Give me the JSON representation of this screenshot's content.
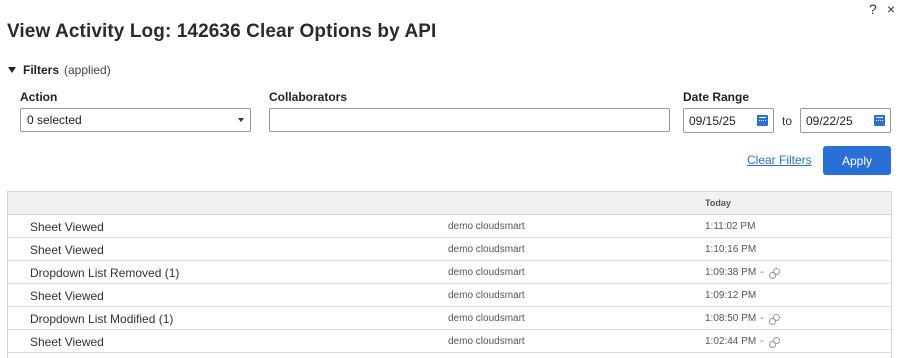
{
  "header": {
    "title": "View Activity Log: 142636 Clear Options by API",
    "help_icon": "?",
    "close_icon": "×"
  },
  "filters": {
    "label": "Filters",
    "status": "(applied)",
    "action_label": "Action",
    "action_value": "0 selected",
    "collaborators_label": "Collaborators",
    "collaborators_value": "",
    "date_range_label": "Date Range",
    "date_from": "09/15/25",
    "date_to": "09/22/25",
    "to_label": "to",
    "clear_filters_label": "Clear Filters",
    "apply_label": "Apply"
  },
  "table": {
    "group_header": "Today",
    "rows": [
      {
        "action": "Sheet Viewed",
        "collaborator": "demo cloudsmart",
        "time": "1:11:02 PM",
        "has_link": false
      },
      {
        "action": "Sheet Viewed",
        "collaborator": "demo cloudsmart",
        "time": "1:10:16 PM",
        "has_link": false
      },
      {
        "action": "Dropdown List Removed (1)",
        "collaborator": "demo cloudsmart",
        "time": "1:09:38 PM",
        "has_link": true
      },
      {
        "action": "Sheet Viewed",
        "collaborator": "demo cloudsmart",
        "time": "1:09:12 PM",
        "has_link": false
      },
      {
        "action": "Dropdown List Modified (1)",
        "collaborator": "demo cloudsmart",
        "time": "1:08:50 PM",
        "has_link": true
      },
      {
        "action": "Sheet Viewed",
        "collaborator": "demo cloudsmart",
        "time": "1:02:44 PM",
        "has_link": true
      }
    ],
    "dash": "-"
  },
  "colors": {
    "accent": "#2a6fd6",
    "header_bg": "#f1f1f1"
  }
}
